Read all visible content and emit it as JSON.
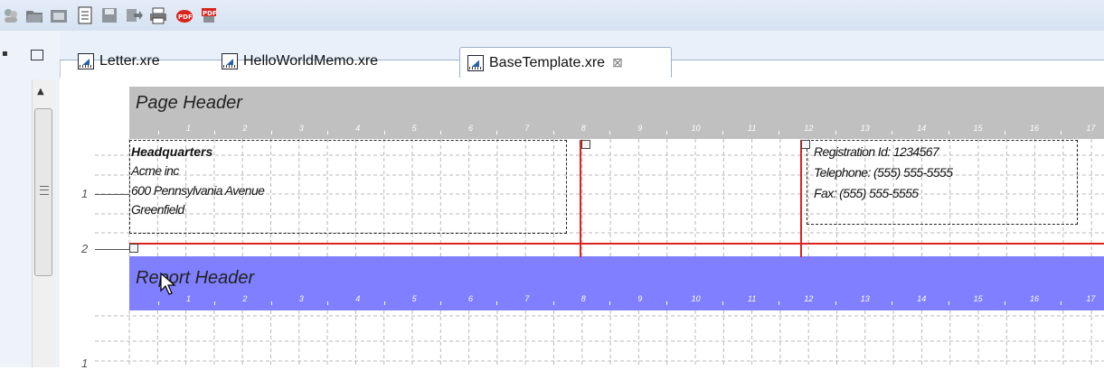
{
  "tabs": [
    {
      "label": "Letter.xre",
      "active": false
    },
    {
      "label": "HelloWorldMemo.xre",
      "active": false
    },
    {
      "label": "BaseTemplate.xre",
      "active": true,
      "close": "⊠"
    }
  ],
  "bands": {
    "page_header": "Page Header",
    "report_header": "Report Header"
  },
  "ruler_numbers": [
    "1",
    "2",
    "3",
    "4",
    "5",
    "6",
    "7",
    "8",
    "9",
    "10",
    "11",
    "12",
    "13",
    "14",
    "15",
    "16",
    "17"
  ],
  "row_labels": [
    "1",
    "2",
    "1"
  ],
  "address_block": {
    "title": "Headquarters",
    "lines": [
      "Acme inc",
      "600 Pennsylvania Avenue",
      "Greenfield"
    ]
  },
  "contact_block": {
    "lines": [
      "Registration Id: 1234567",
      "Telephone: (555) 555-5555",
      "Fax: (555) 555-5555"
    ]
  },
  "colors": {
    "page_header_band": "#c0c0c0",
    "report_header_band": "#7f7fff",
    "guide_line": "#e02020"
  }
}
